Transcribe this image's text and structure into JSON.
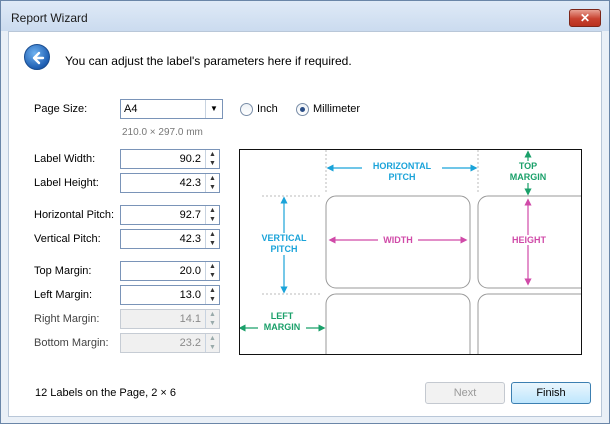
{
  "window": {
    "title": "Report Wizard",
    "close_label": "✕"
  },
  "header": {
    "text": "You can adjust the label's parameters here if required."
  },
  "page_size": {
    "label": "Page Size:",
    "selected": "A4",
    "dimensions": "210.0 × 297.0 mm",
    "units": {
      "inch_label": "Inch",
      "millimeter_label": "Millimeter",
      "selected": "Millimeter"
    }
  },
  "fields": {
    "label_width": {
      "label": "Label Width:",
      "value": "90.2"
    },
    "label_height": {
      "label": "Label Height:",
      "value": "42.3"
    },
    "horizontal_pitch": {
      "label": "Horizontal Pitch:",
      "value": "92.7"
    },
    "vertical_pitch": {
      "label": "Vertical Pitch:",
      "value": "42.3"
    },
    "top_margin": {
      "label": "Top Margin:",
      "value": "20.0"
    },
    "left_margin": {
      "label": "Left Margin:",
      "value": "13.0"
    },
    "right_margin": {
      "label": "Right Margin:",
      "value": "14.1"
    },
    "bottom_margin": {
      "label": "Bottom Margin:",
      "value": "23.2"
    }
  },
  "preview": {
    "horizontal_pitch_1": "HORIZONTAL",
    "horizontal_pitch_2": "PITCH",
    "top_margin_1": "TOP",
    "top_margin_2": "MARGIN",
    "vertical_pitch_1": "VERTICAL",
    "vertical_pitch_2": "PITCH",
    "width": "WIDTH",
    "height": "HEIGHT",
    "left_margin_1": "LEFT",
    "left_margin_2": "MARGIN",
    "colors": {
      "cyan": "#1aa3d9",
      "magenta": "#d04aa8",
      "green": "#1aa06a"
    }
  },
  "footer": {
    "summary": "12 Labels on the Page, 2 × 6",
    "next_label": "Next",
    "finish_label": "Finish"
  }
}
